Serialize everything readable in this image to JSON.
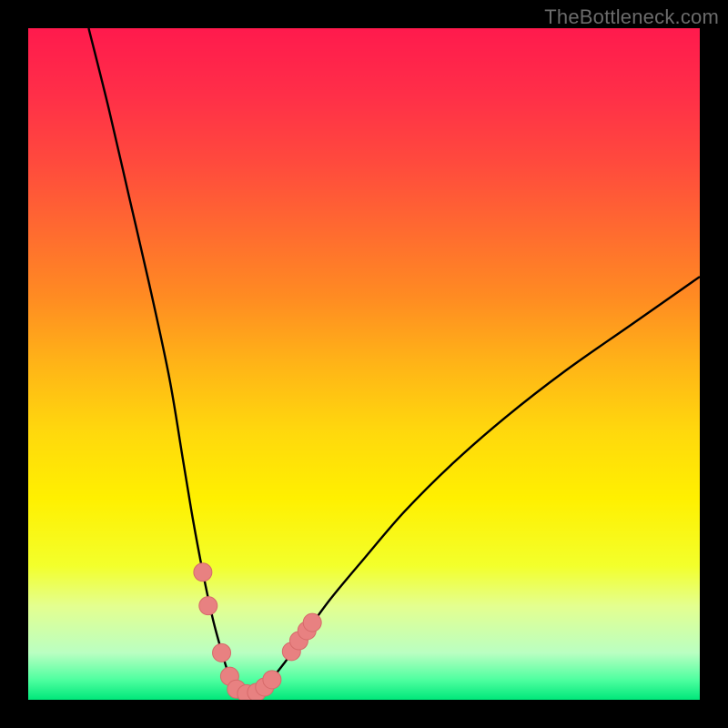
{
  "watermark": "TheBottleneck.com",
  "colors": {
    "frame": "#000000",
    "curve": "#000000",
    "marker_fill": "#e88181",
    "marker_stroke": "#d66a6a",
    "gradient_stops": [
      {
        "offset": 0.0,
        "color": "#ff1a4d"
      },
      {
        "offset": 0.1,
        "color": "#ff2f48"
      },
      {
        "offset": 0.2,
        "color": "#ff4a3d"
      },
      {
        "offset": 0.3,
        "color": "#ff6a30"
      },
      {
        "offset": 0.4,
        "color": "#ff8b22"
      },
      {
        "offset": 0.5,
        "color": "#ffb417"
      },
      {
        "offset": 0.6,
        "color": "#ffd80d"
      },
      {
        "offset": 0.7,
        "color": "#fff000"
      },
      {
        "offset": 0.8,
        "color": "#f3ff2b"
      },
      {
        "offset": 0.86,
        "color": "#e4ff8f"
      },
      {
        "offset": 0.93,
        "color": "#baffc2"
      },
      {
        "offset": 0.97,
        "color": "#4fffa0"
      },
      {
        "offset": 1.0,
        "color": "#00e77a"
      }
    ]
  },
  "chart_data": {
    "type": "line",
    "title": "",
    "xlabel": "",
    "ylabel": "",
    "xlim": [
      0,
      100
    ],
    "ylim": [
      0,
      100
    ],
    "grid": false,
    "legend": false,
    "series": [
      {
        "name": "bottleneck-curve",
        "x": [
          9,
          12,
          15,
          18,
          21,
          23,
          24.5,
          26,
          27.5,
          29,
          30,
          31,
          32,
          33,
          34,
          35.5,
          38,
          41,
          45,
          50,
          56,
          63,
          71,
          80,
          90,
          100
        ],
        "y": [
          100,
          88,
          75,
          62,
          48,
          36,
          27,
          19,
          12,
          6.5,
          3.4,
          1.5,
          0.7,
          0.7,
          1.2,
          2.3,
          5.3,
          9.5,
          15,
          21,
          28,
          35,
          42,
          49,
          56,
          63
        ]
      }
    ],
    "markers": {
      "name": "data-points",
      "points": [
        {
          "x": 26.0,
          "y": 19.0
        },
        {
          "x": 26.8,
          "y": 14.0
        },
        {
          "x": 28.8,
          "y": 7.0
        },
        {
          "x": 30.0,
          "y": 3.5
        },
        {
          "x": 31.0,
          "y": 1.6
        },
        {
          "x": 32.5,
          "y": 0.9
        },
        {
          "x": 34.0,
          "y": 1.1
        },
        {
          "x": 35.2,
          "y": 1.9
        },
        {
          "x": 36.3,
          "y": 3.0
        },
        {
          "x": 39.2,
          "y": 7.2
        },
        {
          "x": 40.3,
          "y": 8.8
        },
        {
          "x": 41.5,
          "y": 10.3
        },
        {
          "x": 42.3,
          "y": 11.5
        }
      ]
    }
  }
}
